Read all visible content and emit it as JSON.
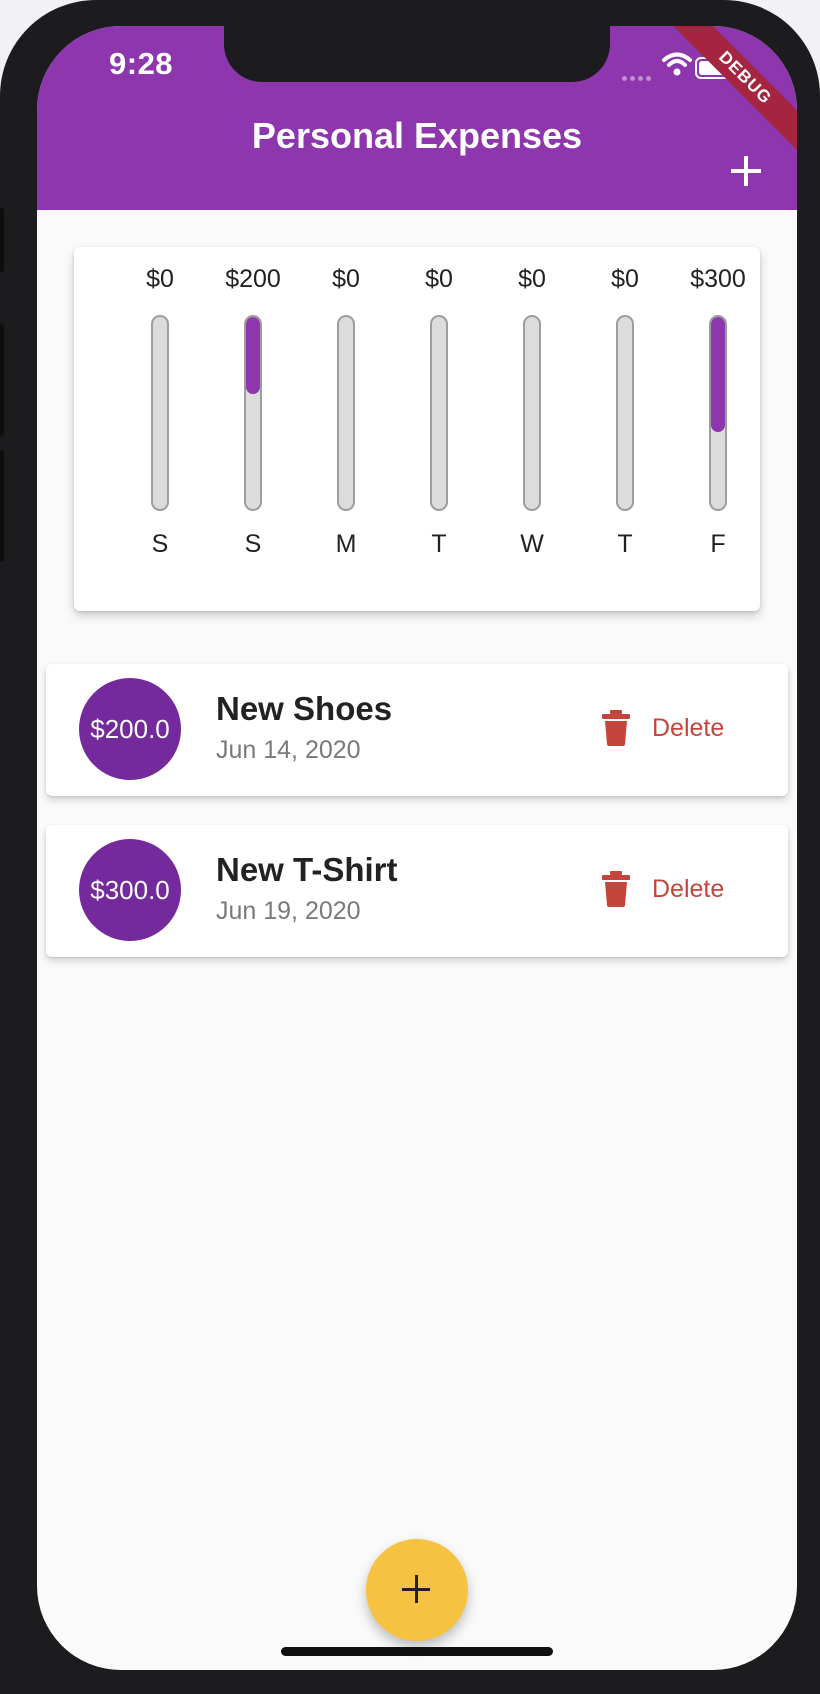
{
  "status_bar": {
    "time": "9:28",
    "debug_banner": "DEBUG"
  },
  "app_bar": {
    "title": "Personal Expenses",
    "add_icon": "plus-icon"
  },
  "chart_data": {
    "type": "bar",
    "categories": [
      "S",
      "S",
      "M",
      "T",
      "W",
      "T",
      "F"
    ],
    "value_labels": [
      "$0",
      "$200",
      "$0",
      "$0",
      "$0",
      "$0",
      "$300"
    ],
    "values": [
      0,
      200,
      0,
      0,
      0,
      0,
      300
    ],
    "fill_fraction": [
      0,
      0.4,
      0,
      0,
      0,
      0,
      0.6
    ],
    "bar_color": "#8e36ad",
    "track_color": "#dcdcdc"
  },
  "transactions": [
    {
      "amount": "$200.0",
      "title": "New Shoes",
      "date": "Jun 14, 2020",
      "delete_label": "Delete"
    },
    {
      "amount": "$300.0",
      "title": "New T-Shirt",
      "date": "Jun 19, 2020",
      "delete_label": "Delete"
    }
  ],
  "colors": {
    "primary": "#8e36ad",
    "accent": "#f5c242",
    "danger": "#c4453c"
  },
  "fab": {
    "icon": "plus-icon"
  }
}
